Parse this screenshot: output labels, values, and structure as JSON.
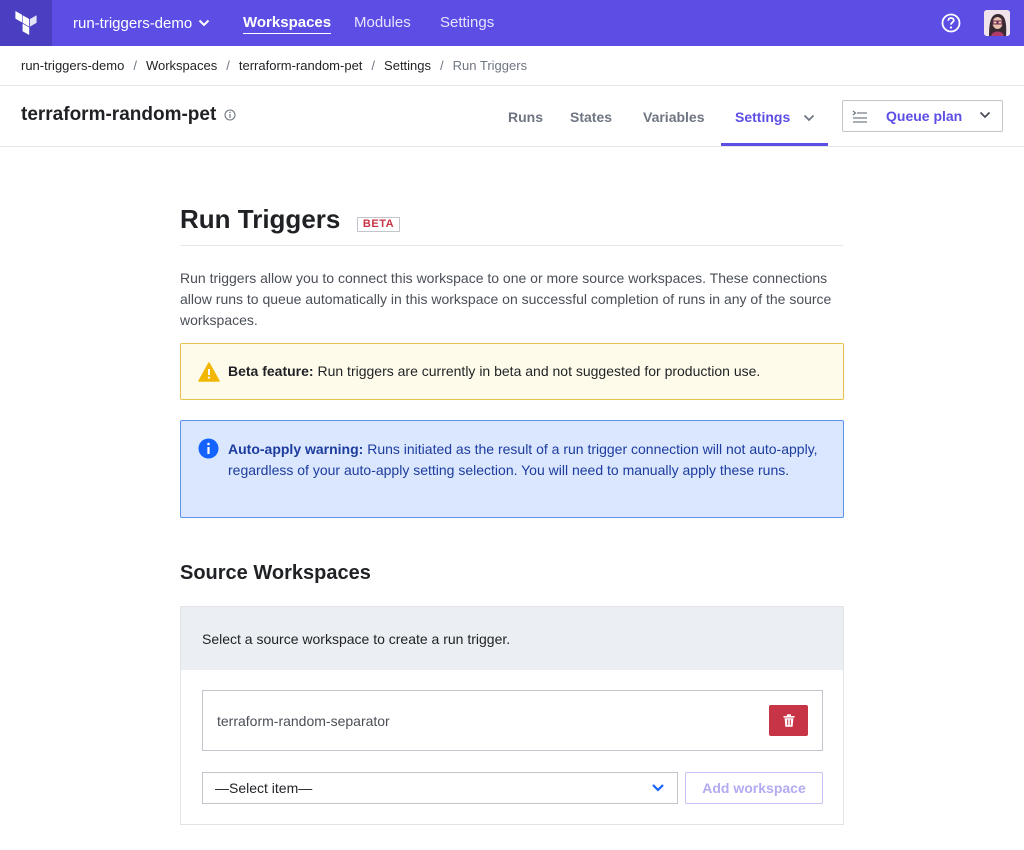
{
  "topnav": {
    "org_name": "run-triggers-demo",
    "links": [
      {
        "label": "Workspaces",
        "active": true
      },
      {
        "label": "Modules",
        "active": false
      },
      {
        "label": "Settings",
        "active": false
      }
    ],
    "help_icon": "question-circle-icon",
    "brand_color": "#5c4ee5"
  },
  "breadcrumb": {
    "items": [
      "run-triggers-demo",
      "Workspaces",
      "terraform-random-pet",
      "Settings"
    ],
    "current": "Run Triggers",
    "separator": "/"
  },
  "workspace": {
    "name": "terraform-random-pet",
    "tabs": [
      "Runs",
      "States",
      "Variables",
      "Settings"
    ],
    "active_tab": "Settings",
    "queue_plan_label": "Queue plan"
  },
  "page": {
    "title": "Run Triggers",
    "badge": "BETA",
    "intro": "Run triggers allow you to connect this workspace to one or more source workspaces. These connections allow runs to queue automatically in this workspace on successful completion of runs in any of the source workspaces."
  },
  "alerts": {
    "beta": {
      "title": "Beta feature:",
      "text": " Run triggers are currently in beta and not suggested for production use.",
      "icon": "warning-triangle-icon",
      "color": "#e5c44c"
    },
    "auto_apply": {
      "title": "Auto-apply warning:",
      "text": " Runs initiated as the result of a run trigger connection will not auto-apply, regardless of your auto-apply setting selection. You will need to manually apply these runs.",
      "icon": "info-circle-icon",
      "color": "#1563ff"
    }
  },
  "source_workspaces": {
    "title": "Source Workspaces",
    "instruction": "Select a source workspace to create a run trigger.",
    "connected": [
      "terraform-random-separator"
    ],
    "select_value": "—Select item—",
    "add_button_label": "Add workspace",
    "delete_color": "#c73445"
  }
}
